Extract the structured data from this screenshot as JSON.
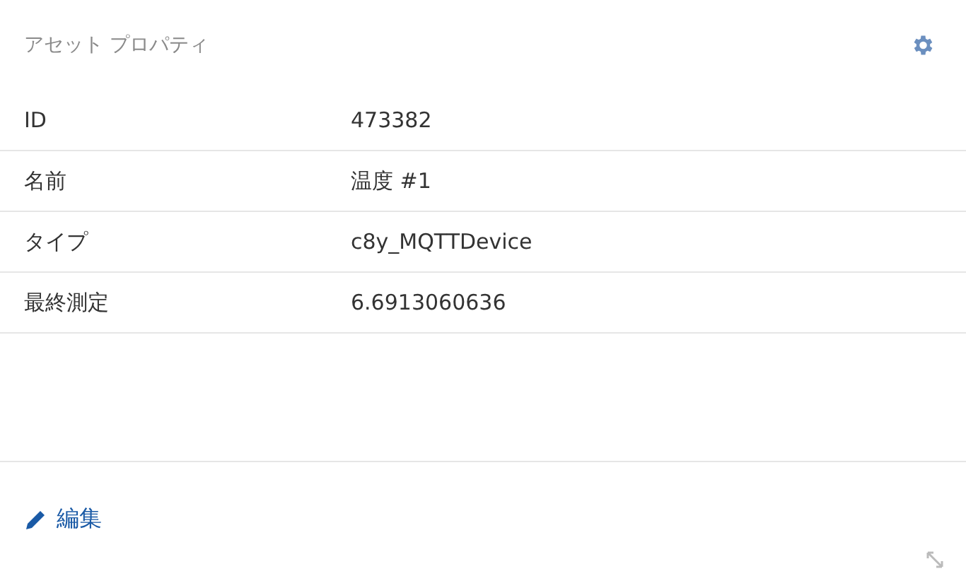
{
  "widget": {
    "title": "アセット プロパティ"
  },
  "properties": [
    {
      "label": "ID",
      "value": "473382"
    },
    {
      "label": "名前",
      "value": "温度 #1"
    },
    {
      "label": "タイプ",
      "value": "c8y_MQTTDevice"
    },
    {
      "label": "最終測定",
      "value": "6.6913060636"
    }
  ],
  "edit_link": "編集"
}
